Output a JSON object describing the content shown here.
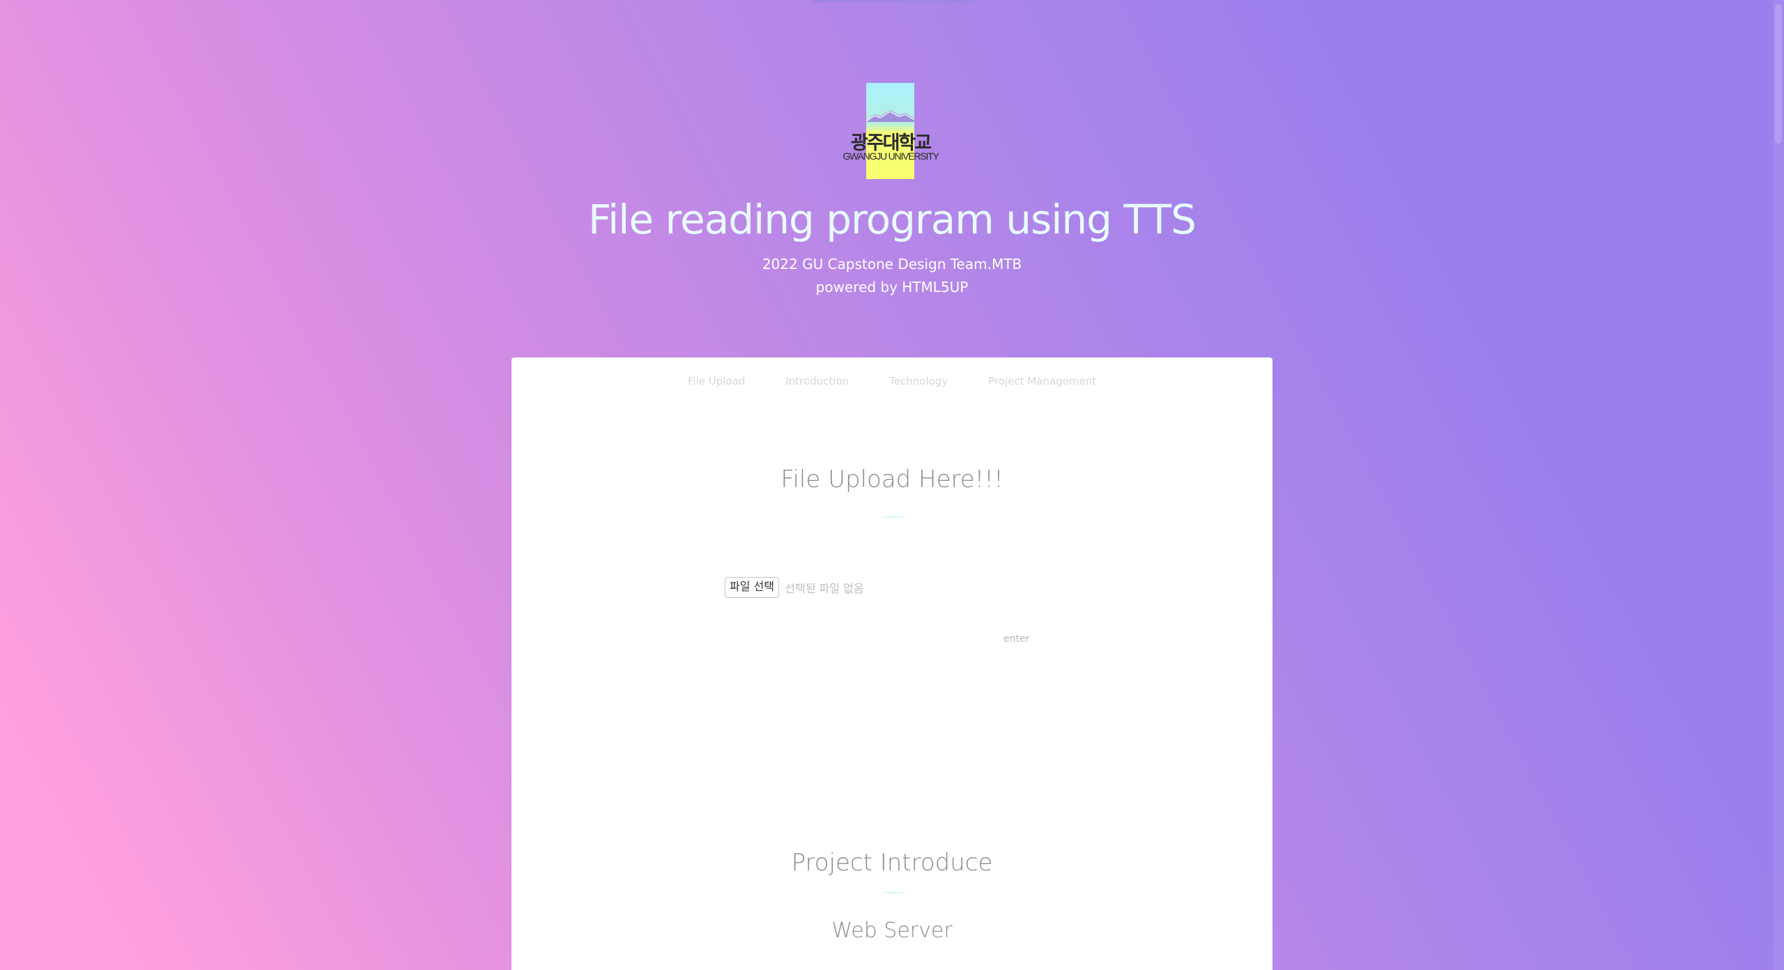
{
  "logo": {
    "korean": "광주대학교",
    "english": "GWANGJU UNIVERSITY",
    "colors": {
      "sky": "#a9f0ff",
      "field": "#f8ff6e",
      "mountain": "#9a7fd8"
    }
  },
  "header": {
    "title": "File reading program using TTS",
    "subtitle_line1": "2022 GU Capstone Design Team.MTB",
    "subtitle_line2": "powered by HTML5UP"
  },
  "nav": {
    "items": [
      {
        "label": "File Upload"
      },
      {
        "label": "Introduction"
      },
      {
        "label": "Technology"
      },
      {
        "label": "Project Management"
      }
    ]
  },
  "upload": {
    "title": "File Upload Here!!!",
    "choose_file_label": "파일 선택",
    "no_file_label": "선택된 파일 없음",
    "enter_label": "enter"
  },
  "intro": {
    "title": "Project Introduce",
    "subtitle": "Web Server"
  },
  "colors": {
    "gradient_pink": "#ff9fde",
    "gradient_violet": "#9a80ec",
    "title_color": "#e8fbff"
  }
}
